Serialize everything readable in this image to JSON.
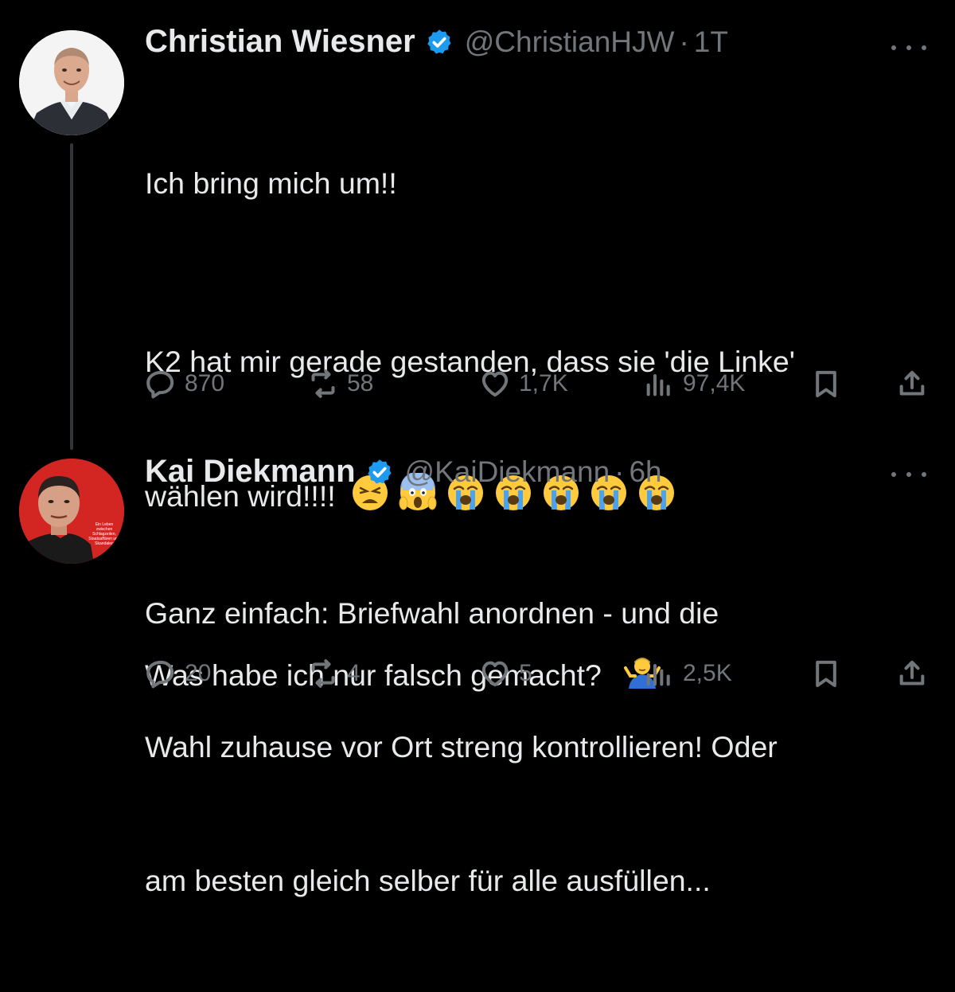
{
  "tweets": [
    {
      "name": "Christian Wiesner",
      "handle": "@ChristianHJW",
      "separator": "·",
      "time": "1T",
      "paragraphs": [
        "Ich bring mich um!!",
        "K2 hat mir gerade gestanden, dass sie 'die Linke'",
        "wählen wird!!!!",
        "Was habe ich nur falsch gemacht?"
      ],
      "emoji_line": [
        "weary-face",
        "face-screaming-in-fear",
        "loudly-crying-face",
        "loudly-crying-face",
        "loudly-crying-face",
        "loudly-crying-face",
        "loudly-crying-face"
      ],
      "trailing_emoji": "man-shrugging",
      "stats": {
        "replies": "870",
        "reposts": "58",
        "likes": "1,7K",
        "views": "97,4K"
      }
    },
    {
      "name": "Kai Diekmann",
      "handle": "@KaiDiekmann",
      "separator": "·",
      "time": "6h",
      "paragraphs": [
        "Ganz einfach: Briefwahl anordnen - und die",
        "Wahl zuhause vor Ort streng kontrollieren! Oder",
        "am besten gleich selber für alle ausfüllen..."
      ],
      "avatar_caption": "Ein Leben zwischen Schlagzeilen, Staatsaffären und Skandalen",
      "stats": {
        "replies": "20",
        "reposts": "4",
        "likes": "5",
        "views": "2,5K"
      }
    }
  ],
  "colors": {
    "background": "#000000",
    "text": "#e7e9ea",
    "muted": "#71767b",
    "verified": "#1d9bf0",
    "thread_line": "#333639"
  }
}
